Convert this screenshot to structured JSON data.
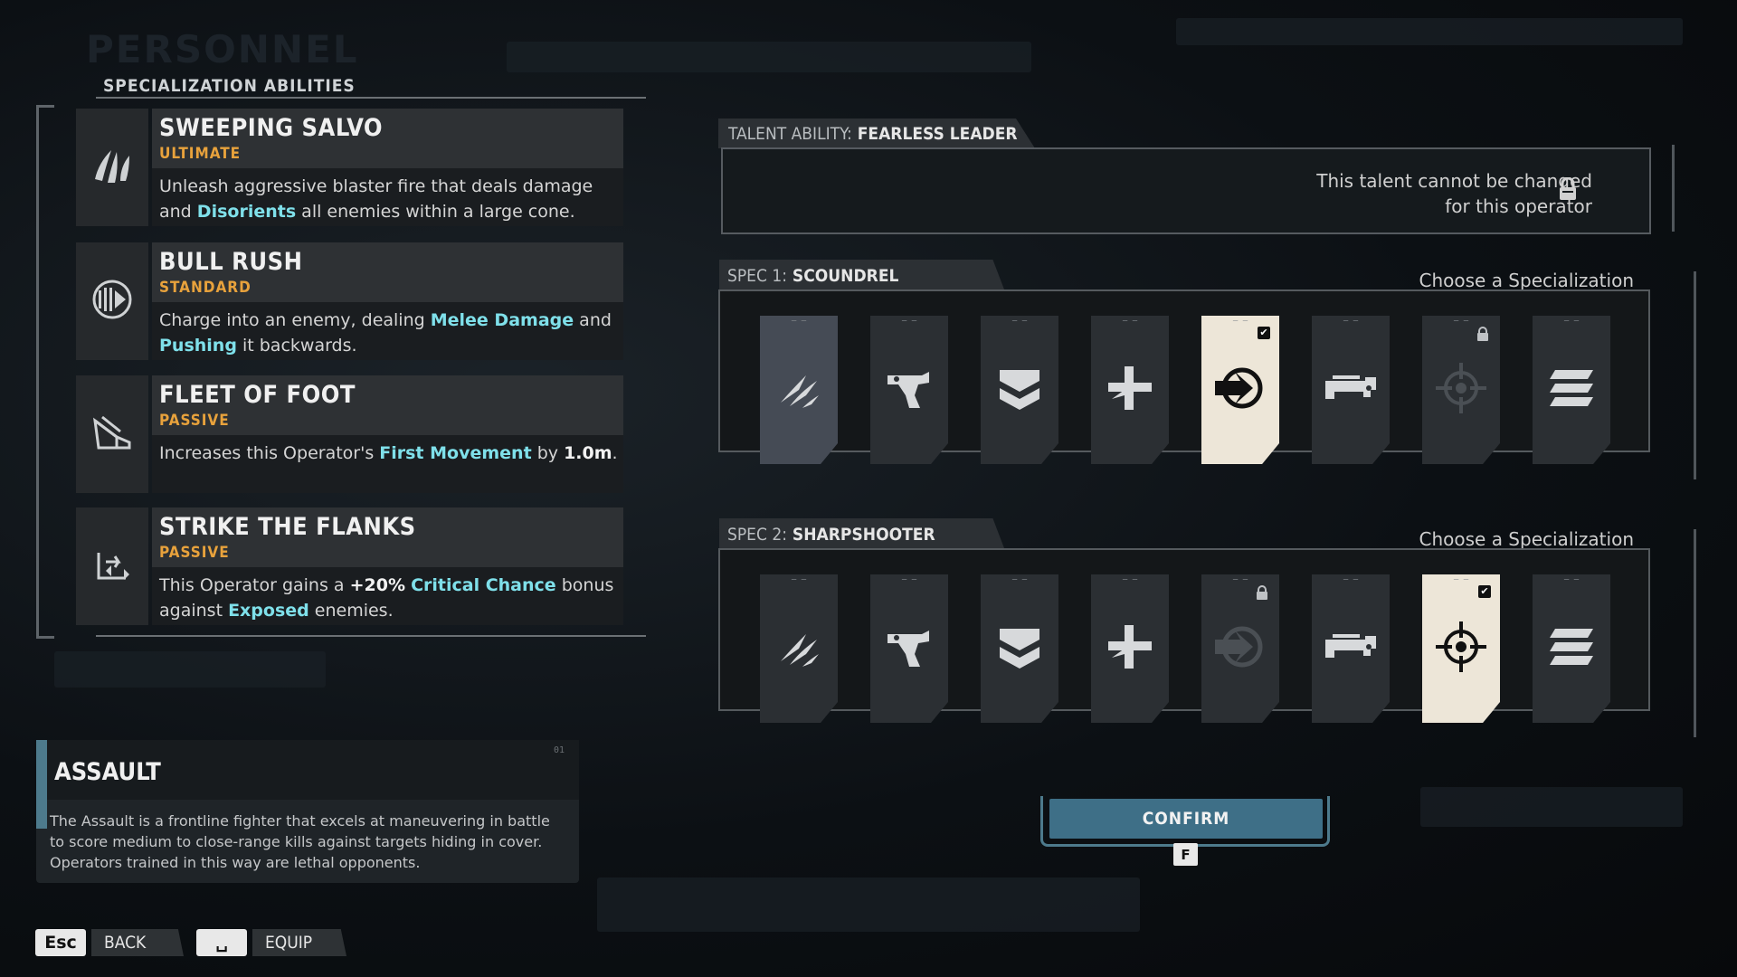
{
  "background": {
    "title": "PERSONNEL"
  },
  "abilities_panel": {
    "title": "SPECIALIZATION ABILITIES",
    "abilities": [
      {
        "name": "SWEEPING SALVO",
        "type": "ULTIMATE",
        "icon": "claw-salvo-icon",
        "desc": [
          {
            "t": "Unleash aggressive blaster fire that deals damage and "
          },
          {
            "t": "Disorients",
            "h": "c"
          },
          {
            "t": " all enemies within a large cone."
          }
        ]
      },
      {
        "name": "BULL RUSH",
        "type": "STANDARD",
        "icon": "rush-dash-icon",
        "desc": [
          {
            "t": "Charge into an enemy, dealing "
          },
          {
            "t": "Melee Damage",
            "h": "c"
          },
          {
            "t": " and "
          },
          {
            "t": "Pushing",
            "h": "c"
          },
          {
            "t": " it backwards."
          }
        ]
      },
      {
        "name": "FLEET OF FOOT",
        "type": "PASSIVE",
        "icon": "running-foot-icon",
        "desc": [
          {
            "t": "Increases this Operator's "
          },
          {
            "t": "First Movement",
            "h": "c"
          },
          {
            "t": " by "
          },
          {
            "t": "1.0m",
            "h": "w"
          },
          {
            "t": "."
          }
        ]
      },
      {
        "name": "STRIKE THE FLANKS",
        "type": "PASSIVE",
        "icon": "flank-arrows-icon",
        "desc": [
          {
            "t": "This Operator gains a "
          },
          {
            "t": "+20%",
            "h": "w"
          },
          {
            "t": " "
          },
          {
            "t": "Critical Chance",
            "h": "c"
          },
          {
            "t": " bonus against "
          },
          {
            "t": "Exposed",
            "h": "c"
          },
          {
            "t": " enemies."
          }
        ]
      }
    ]
  },
  "class_card": {
    "name": "ASSAULT",
    "number": "01",
    "description": "The Assault is a frontline fighter that excels at maneuvering in battle to score medium to close-range kills against targets hiding in cover. Operators trained in this way are lethal opponents."
  },
  "footer": {
    "back_key": "Esc",
    "back_label": "BACK",
    "equip_key": "␣",
    "equip_label": "EQUIP"
  },
  "talent": {
    "label": "TALENT ABILITY:",
    "name": "FEARLESS LEADER",
    "message_line1": "This talent cannot be changed",
    "message_line2": "for this operator"
  },
  "spec1": {
    "label": "SPEC 1:",
    "name": "SCOUNDREL",
    "choose": "Choose a Specialization",
    "cards": [
      {
        "icon": "claw-icon",
        "state": "hover"
      },
      {
        "icon": "pistol-hand-icon",
        "state": "normal"
      },
      {
        "icon": "chevron-shield-icon",
        "state": "normal"
      },
      {
        "icon": "medic-cross-icon",
        "state": "normal"
      },
      {
        "icon": "arrow-circle-icon",
        "state": "selected"
      },
      {
        "icon": "heavy-blaster-icon",
        "state": "normal"
      },
      {
        "icon": "crosshair-icon",
        "state": "locked"
      },
      {
        "icon": "layers-icon",
        "state": "normal"
      }
    ]
  },
  "spec2": {
    "label": "SPEC 2:",
    "name": "SHARPSHOOTER",
    "choose": "Choose a Specialization",
    "cards": [
      {
        "icon": "claw-icon",
        "state": "normal"
      },
      {
        "icon": "pistol-hand-icon",
        "state": "normal"
      },
      {
        "icon": "chevron-shield-icon",
        "state": "normal"
      },
      {
        "icon": "medic-cross-icon",
        "state": "normal"
      },
      {
        "icon": "arrow-circle-icon",
        "state": "locked"
      },
      {
        "icon": "heavy-blaster-icon",
        "state": "normal"
      },
      {
        "icon": "crosshair-icon",
        "state": "selected"
      },
      {
        "icon": "layers-icon",
        "state": "normal"
      }
    ]
  },
  "confirm": {
    "label": "CONFIRM",
    "key": "F"
  }
}
